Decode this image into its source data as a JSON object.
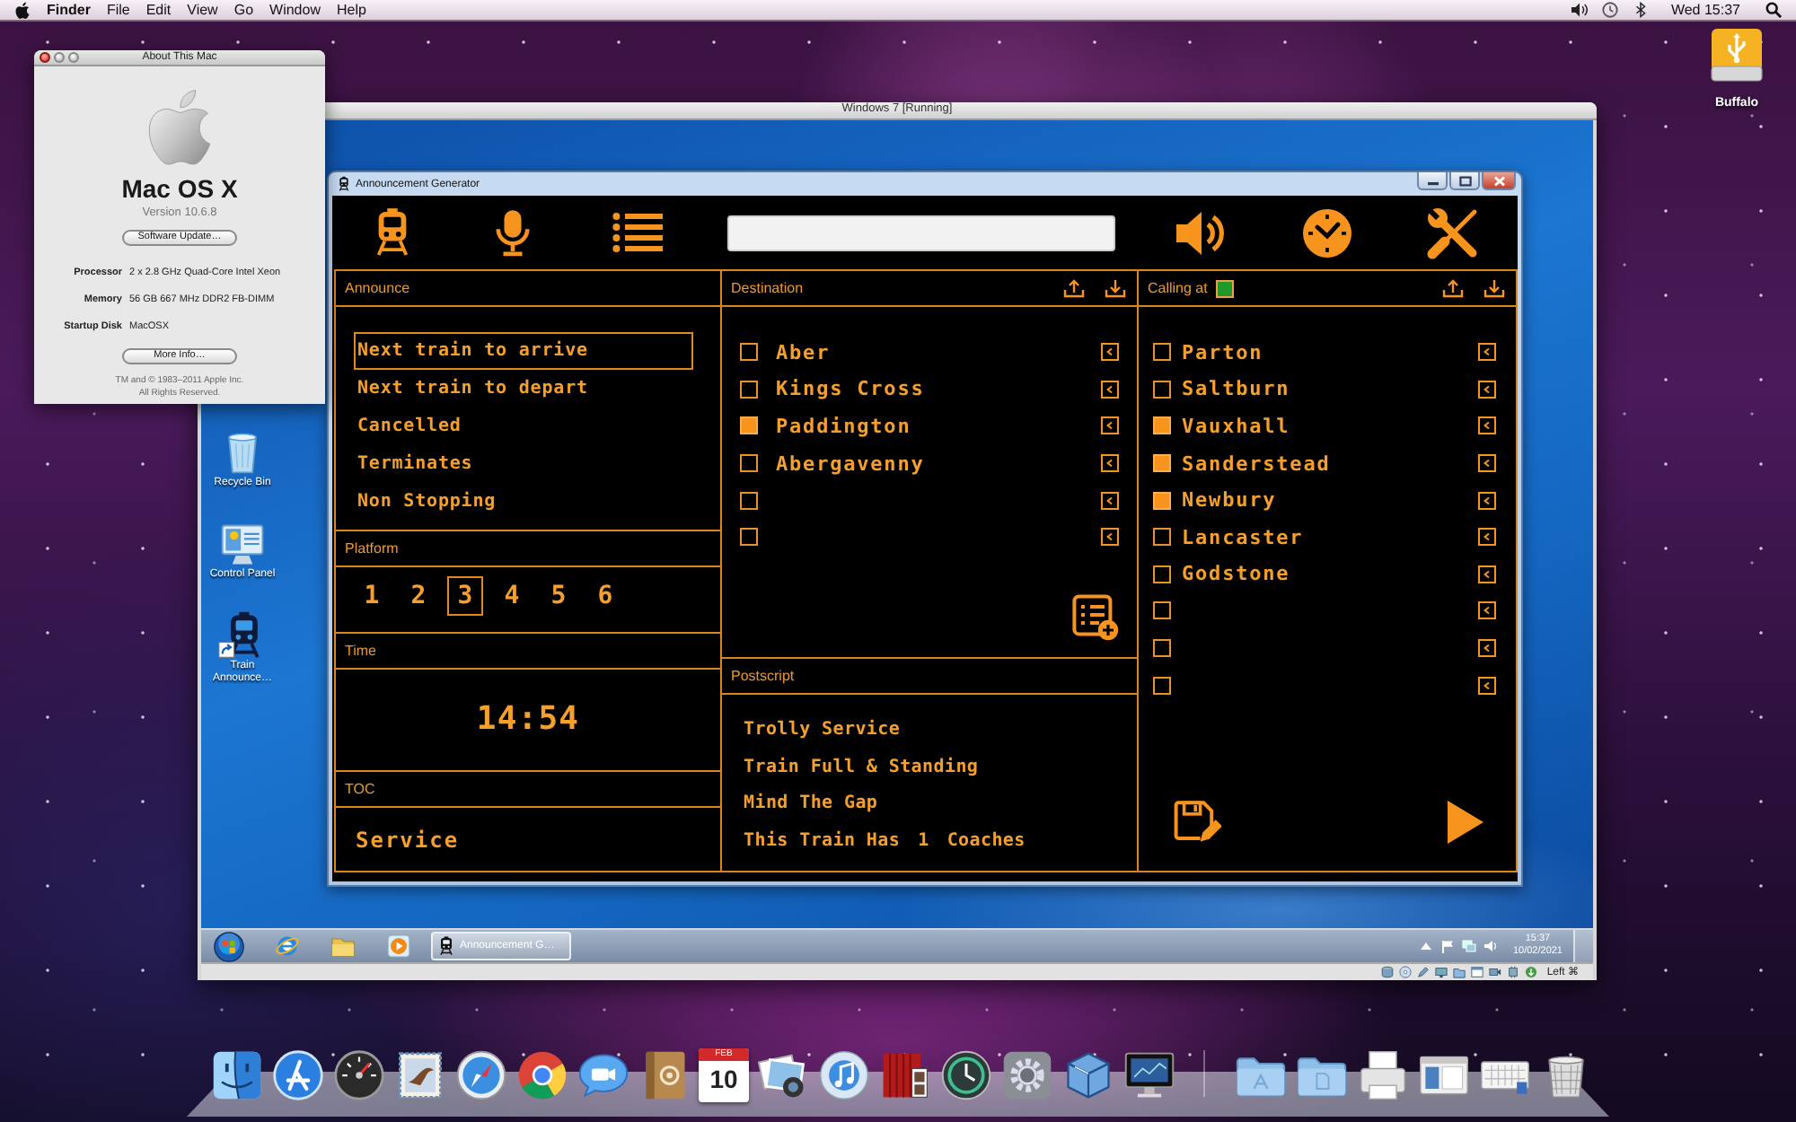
{
  "menubar": {
    "menus": [
      {
        "label": "Finder"
      },
      {
        "label": "File"
      },
      {
        "label": "Edit"
      },
      {
        "label": "View"
      },
      {
        "label": "Go"
      },
      {
        "label": "Window"
      },
      {
        "label": "Help"
      }
    ],
    "clock": "Wed 15:37"
  },
  "about_window": {
    "title": "About This Mac",
    "product": "Mac OS X",
    "version": "Version 10.6.8",
    "update_button": "Software Update…",
    "specs": [
      {
        "label": "Processor",
        "value": "2 x 2.8 GHz Quad-Core Intel Xeon"
      },
      {
        "label": "Memory",
        "value": "56 GB 667 MHz DDR2 FB-DIMM"
      },
      {
        "label": "Startup Disk",
        "value": "MacOSX"
      }
    ],
    "more_button": "More Info…",
    "legal": [
      "TM and © 1983–2011 Apple Inc.",
      "All Rights Reserved."
    ]
  },
  "desktop_icons": [
    {
      "label": "Buffalo"
    }
  ],
  "vm_window": {
    "title": "Windows 7 [Running]",
    "host_key": "Left ⌘"
  },
  "guest_desktop": {
    "icons": [
      {
        "kind": "bin",
        "label": "Recycle Bin"
      },
      {
        "kind": "control",
        "label": "Control Panel"
      },
      {
        "kind": "train",
        "label": "Train Announce…"
      }
    ]
  },
  "app_window": {
    "title": "Announcement Generator",
    "announce": {
      "title": "Announce",
      "options": [
        {
          "label": "Next train to arrive",
          "selected": true
        },
        {
          "label": "Next train to depart",
          "selected": false
        },
        {
          "label": "Cancelled",
          "selected": false
        },
        {
          "label": "Terminates",
          "selected": false
        },
        {
          "label": "Non Stopping",
          "selected": false
        }
      ]
    },
    "platform": {
      "title": "Platform",
      "numbers": [
        {
          "label": "1",
          "selected": false
        },
        {
          "label": "2",
          "selected": false
        },
        {
          "label": "3",
          "selected": true
        },
        {
          "label": "4",
          "selected": false
        },
        {
          "label": "5",
          "selected": false
        },
        {
          "label": "6",
          "selected": false
        }
      ]
    },
    "time": {
      "title": "Time",
      "value": "14:54"
    },
    "toc": {
      "title": "TOC",
      "value": "Service"
    },
    "destination": {
      "title": "Destination",
      "stations": [
        {
          "name": "Aber",
          "checked": false
        },
        {
          "name": "Kings Cross",
          "checked": false
        },
        {
          "name": "Paddington",
          "checked": true
        },
        {
          "name": "Abergavenny",
          "checked": false
        },
        {
          "checked": false
        },
        {
          "checked": false
        }
      ]
    },
    "postscript": {
      "title": "Postscript",
      "lines": [
        {
          "kind": "text",
          "text": "Trolly Service"
        },
        {
          "kind": "text",
          "text": "Train Full & Standing"
        },
        {
          "kind": "text",
          "text": "Mind The Gap"
        },
        {
          "kind": "count",
          "before": "This Train Has",
          "count": "1",
          "after": "Coaches"
        }
      ]
    },
    "calling_at": {
      "title": "Calling at",
      "checked": true,
      "stations": [
        {
          "name": "Parton",
          "checked": false
        },
        {
          "name": "Saltburn",
          "checked": false
        },
        {
          "name": "Vauxhall",
          "checked": true
        },
        {
          "name": "Sanderstead",
          "checked": true
        },
        {
          "name": "Newbury",
          "checked": true
        },
        {
          "name": "Lancaster",
          "checked": false
        },
        {
          "name": "Godstone",
          "checked": false
        },
        {
          "checked": false
        },
        {
          "checked": false
        },
        {
          "checked": false
        }
      ]
    }
  },
  "taskbar": {
    "windows": [
      {
        "label": "Announcement G…",
        "selected": true
      }
    ],
    "time": "15:37",
    "date": "10/02/2021"
  },
  "dock": {
    "calendar_month": "FEB",
    "calendar_day": "10"
  }
}
